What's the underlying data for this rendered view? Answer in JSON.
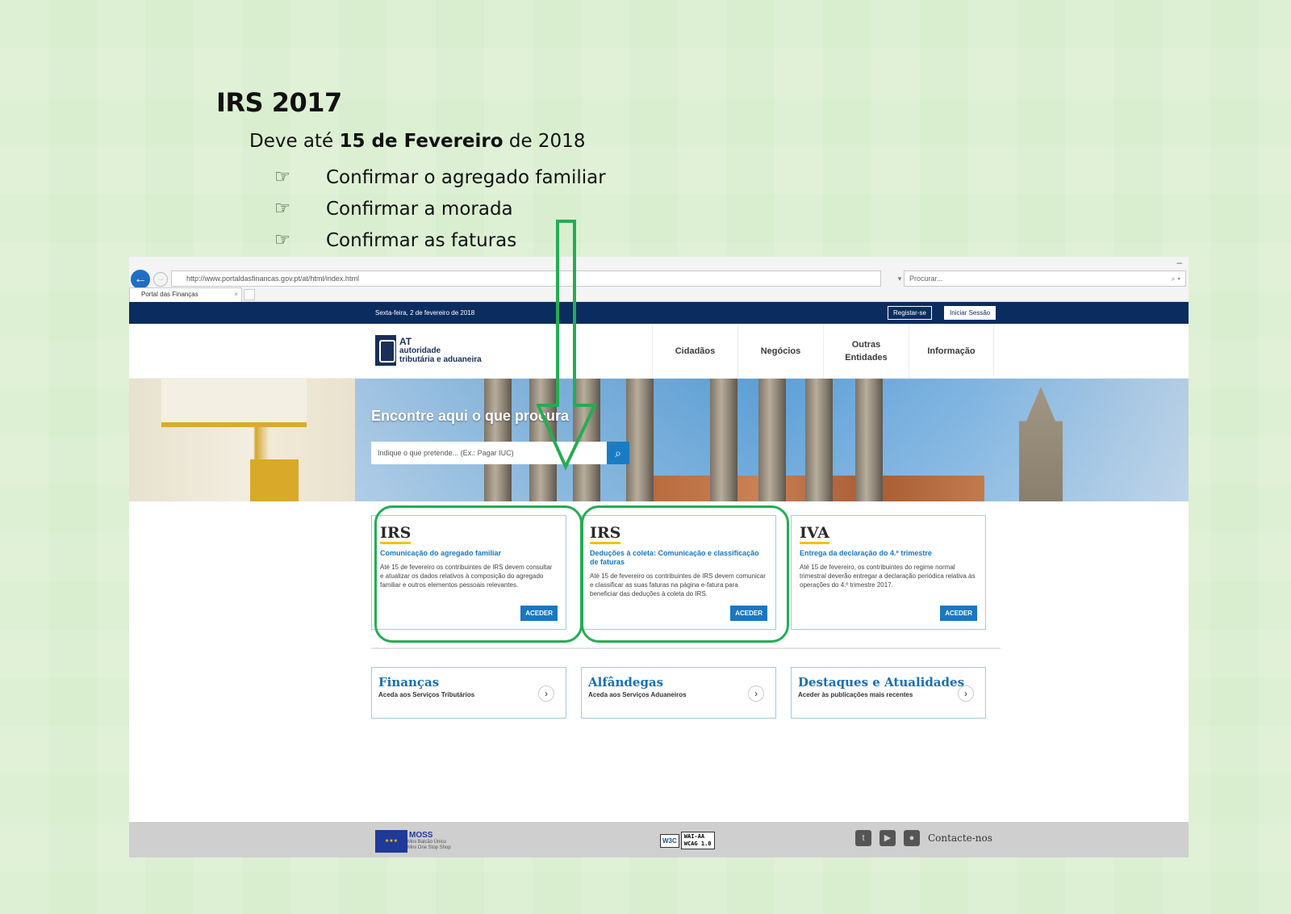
{
  "doc": {
    "title": "IRS 2017",
    "deadline_prefix": "Deve até ",
    "deadline_bold": "15 de Fevereiro",
    "deadline_suffix": " de 2018",
    "tasks": [
      "Confirmar o agregado familiar",
      "Confirmar a morada",
      "Confirmar as faturas"
    ],
    "bullet_icon": "pointing-hand-icon",
    "highlight_color": "#24ad52"
  },
  "browser": {
    "url": "http://www.portaldasfinancas.gov.pt/at/html/index.html",
    "search_placeholder": "Procurar...",
    "tab_label": "Portal das Finanças"
  },
  "portal": {
    "date": "Sexta-feira, 2 de fevereiro de 2018",
    "register": "Registar-se",
    "login": "Iniciar Sessão",
    "logo_line1": "AT",
    "logo_line2": "autoridade",
    "logo_line3": "tributária e aduaneira",
    "menu": [
      "Cidadãos",
      "Negócios",
      "Outras\nEntidades",
      "Informação"
    ],
    "hero_title": "Encontre aqui o que procura",
    "hero_search_placeholder": "Indique o que pretende... (Ex.: Pagar IUC)",
    "cards": [
      {
        "title": "IRS",
        "subtitle": "Comunicação do agregado familiar",
        "description": "Até 15 de fevereiro os contribuintes de IRS devem consultar e atualizar os dados relativos à composição do agregado familiar e outros elementos pessoais relevantes.",
        "button": "ACEDER"
      },
      {
        "title": "IRS",
        "subtitle": "Deduções à coleta: Comunicação e classificação de faturas",
        "description": "Até 15 de fevereiro os contribuintes de IRS devem comunicar e classificar as suas faturas na página e-fatura para beneficiar das deduções à coleta do IRS.",
        "button": "ACEDER"
      },
      {
        "title": "IVA",
        "subtitle": "Entrega da declaração do 4.º trimestre",
        "description": "Até 15 de fevereiro, os contribuintes do regime normal trimestral deverão entregar a declaração periódica relativa às operações do 4.º trimestre 2017.",
        "button": "ACEDER"
      }
    ],
    "links": [
      {
        "title": "Finanças",
        "subtitle": "Aceda aos Serviços Tributários"
      },
      {
        "title": "Alfândegas",
        "subtitle": "Aceda aos Serviços Aduaneiros"
      },
      {
        "title": "Destaques e Atualidades",
        "subtitle": "Aceder às publicações mais recentes"
      }
    ],
    "footer": {
      "moss_title": "MOSS",
      "moss_sub1": "Mini Balcão Único",
      "moss_sub2": "Mini One Stop Shop",
      "w3c": "W3C",
      "wcag_line1": "WAI-AA",
      "wcag_line2": "WCAG 1.0",
      "contact": "Contacte-nos"
    }
  }
}
